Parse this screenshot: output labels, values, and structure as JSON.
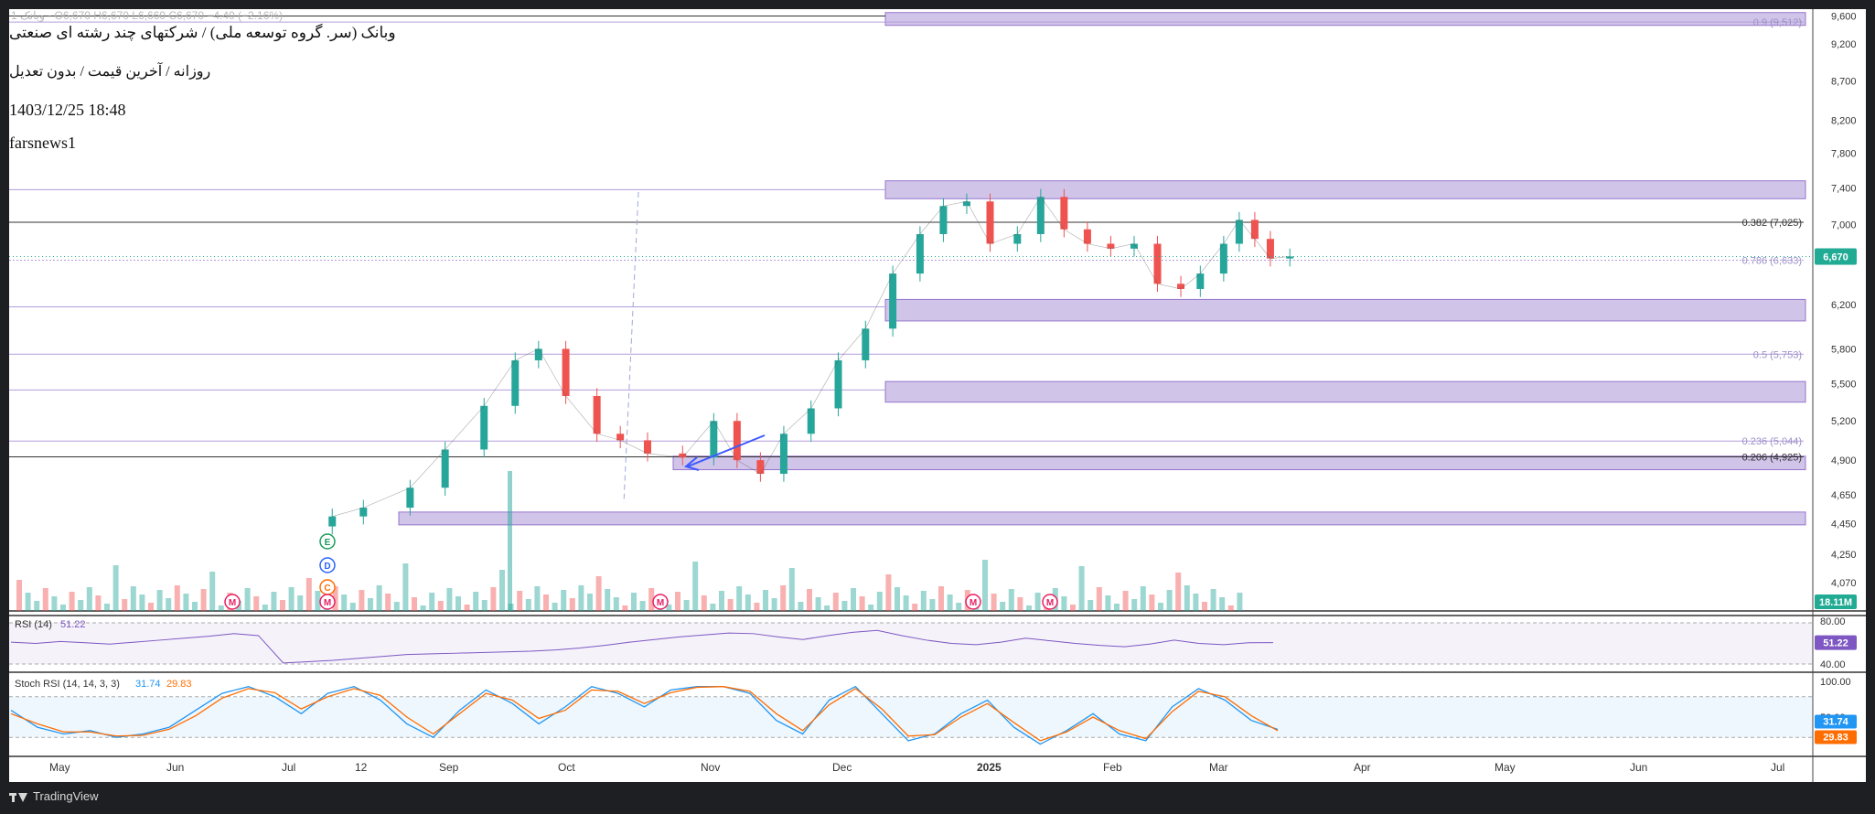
{
  "header": {
    "symbol_line": "وبانک (سر. گروه توسعه ملی) / شرکتهای چند رشته ای صنعتی",
    "series_line": "روزانه / آخرین قیمت / بدون تعدیل",
    "datetime": "1403/12/25 18:48",
    "author": "farsnews1",
    "ohlc_faint": "1 وبانک · O6,670 H6,670 L6,660 C6,670 −4.40 (−2.16%)"
  },
  "footer": {
    "brand": "TradingView"
  },
  "colors": {
    "up": "#26a69a",
    "down": "#ef5350",
    "zone_fill": "#d1c4e9",
    "zone_stroke": "#9575cd",
    "rsi": "#7e57c2",
    "stoch_k": "#2196f3",
    "stoch_d": "#ff6d00",
    "price_badge": "#22ab94"
  },
  "chart_data": [
    {
      "type": "candlestick",
      "scale": "log",
      "title": "وبانک (سر. گروه توسعه ملی) / شرکتهای چند رشته ای صنعتی",
      "x_axis_labels": [
        "May",
        "Jun",
        "Jul",
        "12",
        "Sep",
        "Oct",
        "Nov",
        "Dec",
        "2025",
        "Feb",
        "Mar",
        "Apr",
        "May",
        "Jun",
        "Jul"
      ],
      "y_ticks": [
        4070,
        4250,
        4450,
        4650,
        4900,
        5200,
        5500,
        5800,
        6200,
        6670,
        7000,
        7400,
        7800,
        8200,
        8700,
        9200,
        9600
      ],
      "ylim": [
        3900,
        9700
      ],
      "last_price": "6,670",
      "price_series": {
        "description": "daily close (approx.)",
        "dates": [
          "2024-07-12",
          "2024-07-20",
          "2024-08-01",
          "2024-08-10",
          "2024-08-20",
          "2024-08-28",
          "2024-09-03",
          "2024-09-10",
          "2024-09-18",
          "2024-09-24",
          "2024-10-01",
          "2024-10-10",
          "2024-10-18",
          "2024-10-24",
          "2024-10-30",
          "2024-11-05",
          "2024-11-12",
          "2024-11-19",
          "2024-11-26",
          "2024-12-03",
          "2024-12-10",
          "2024-12-16",
          "2024-12-22",
          "2024-12-28",
          "2025-01-04",
          "2025-01-10",
          "2025-01-16",
          "2025-01-22",
          "2025-01-28",
          "2025-02-03",
          "2025-02-09",
          "2025-02-15",
          "2025-02-20",
          "2025-02-26",
          "2025-03-02",
          "2025-03-06",
          "2025-03-10",
          "2025-03-15"
        ],
        "close": [
          4500,
          4560,
          4700,
          4980,
          5320,
          5700,
          5800,
          5400,
          5100,
          5050,
          4950,
          4920,
          5200,
          4900,
          4800,
          5100,
          5300,
          5700,
          5980,
          6500,
          6900,
          7200,
          7250,
          6800,
          6900,
          7300,
          6950,
          6800,
          6750,
          6800,
          6400,
          6350,
          6500,
          6800,
          7050,
          6850,
          6650,
          6670
        ]
      },
      "fib_levels": [
        {
          "label": "0.236 (5,044)",
          "value": 5044
        },
        {
          "label": "0.5 (5,753)",
          "value": 5753
        },
        {
          "label": "0.786 (6,633)",
          "value": 6633
        },
        {
          "label": "0.382 (7,025)",
          "value": 7025
        },
        {
          "label": "0.9 (9,512)",
          "value": 9512
        },
        {
          "label": "0.206 (4,925)",
          "value": 4925
        }
      ],
      "zones": [
        {
          "low": 9520,
          "high": 9650
        },
        {
          "low": 7280,
          "high": 7480
        },
        {
          "low": 6050,
          "high": 6250
        },
        {
          "low": 5350,
          "high": 5520
        },
        {
          "low": 4830,
          "high": 4930
        },
        {
          "low": 4450,
          "high": 4530
        }
      ],
      "events": [
        "M",
        "E",
        "D",
        "C",
        "M",
        "M",
        "M",
        "M"
      ],
      "volume_last": "18.11M"
    },
    {
      "type": "line",
      "title": "RSI (14)",
      "value": "51.22",
      "levels": [
        30,
        70
      ],
      "y_ticks": [
        "80.00",
        "40.00"
      ],
      "values": [
        52,
        50,
        53,
        51,
        49,
        52,
        55,
        58,
        61,
        65,
        62,
        20,
        22,
        24,
        27,
        30,
        33,
        34,
        35,
        36,
        37,
        38,
        40,
        43,
        47,
        52,
        56,
        60,
        63,
        66,
        65,
        60,
        56,
        62,
        67,
        70,
        62,
        55,
        50,
        48,
        52,
        58,
        54,
        50,
        47,
        45,
        49,
        55,
        50,
        48,
        51,
        51.22
      ]
    },
    {
      "type": "line",
      "title": "Stoch RSI (14, 14, 3, 3)",
      "series": [
        {
          "name": "K",
          "value": "31.74",
          "values": [
            60,
            35,
            25,
            30,
            20,
            25,
            35,
            60,
            85,
            95,
            80,
            55,
            85,
            95,
            75,
            40,
            20,
            60,
            90,
            70,
            40,
            65,
            95,
            85,
            65,
            90,
            95,
            95,
            85,
            45,
            25,
            75,
            95,
            55,
            15,
            25,
            55,
            75,
            35,
            10,
            30,
            55,
            25,
            15,
            65,
            92,
            75,
            45,
            31.74
          ]
        },
        {
          "name": "D",
          "value": "29.83",
          "values": [
            55,
            40,
            28,
            28,
            22,
            23,
            32,
            52,
            78,
            92,
            86,
            62,
            80,
            92,
            82,
            50,
            25,
            55,
            85,
            75,
            48,
            60,
            90,
            88,
            70,
            86,
            94,
            95,
            88,
            55,
            30,
            68,
            92,
            62,
            22,
            24,
            50,
            70,
            42,
            15,
            28,
            50,
            30,
            18,
            58,
            88,
            80,
            52,
            29.83
          ]
        }
      ],
      "y_ticks": [
        "100.00",
        "50.00"
      ],
      "levels": [
        20,
        80
      ]
    }
  ]
}
